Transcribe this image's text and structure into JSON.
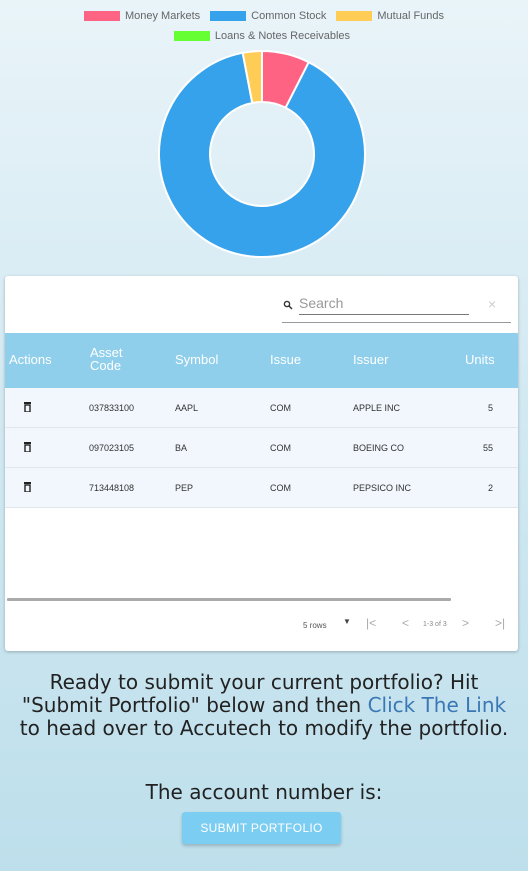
{
  "chart_data": {
    "type": "pie",
    "title": "",
    "legend_position": "top",
    "categories": [
      "Money Markets",
      "Common Stock",
      "Mutual Funds",
      "Loans & Notes Receivables"
    ],
    "values": [
      7.5,
      89.5,
      3.0,
      0
    ],
    "colors": [
      "#ff6384",
      "#36a2eb",
      "#ffcd56",
      "#66ff33"
    ]
  },
  "legend": {
    "row1": [
      {
        "label": "Money Markets",
        "color": "#ff6384"
      },
      {
        "label": "Common Stock",
        "color": "#36a2eb"
      },
      {
        "label": "Mutual Funds",
        "color": "#ffcd56"
      }
    ],
    "row2": [
      {
        "label": "Loans & Notes Receivables",
        "color": "#66ff33"
      }
    ]
  },
  "search": {
    "placeholder": "Search",
    "clear": "×"
  },
  "table": {
    "headers": {
      "actions": "Actions",
      "asset_code_1": "Asset",
      "asset_code_2": "Code",
      "symbol": "Symbol",
      "issue": "Issue",
      "issuer": "Issuer",
      "units": "Units"
    },
    "rows": [
      {
        "asset_code": "037833100",
        "symbol": "AAPL",
        "issue": "COM",
        "issuer": "APPLE INC",
        "units": "5"
      },
      {
        "asset_code": "097023105",
        "symbol": "BA",
        "issue": "COM",
        "issuer": "BOEING CO",
        "units": "55"
      },
      {
        "asset_code": "713448108",
        "symbol": "PEP",
        "issue": "COM",
        "issuer": "PEPSICO INC",
        "units": "2"
      }
    ]
  },
  "pager": {
    "rows_label": "5 rows",
    "page_info": "1-3 of 3",
    "first": "|<",
    "prev": "<",
    "next": ">",
    "last": ">|"
  },
  "message": {
    "before_link": "Ready to submit your current portfolio? Hit \"Submit Portfolio\" below and then ",
    "link": "Click The Link",
    "after_link": " to head over to Accutech to modify the portfolio."
  },
  "account_label": "The account number is:",
  "submit_label": "SUBMIT PORTFOLIO"
}
